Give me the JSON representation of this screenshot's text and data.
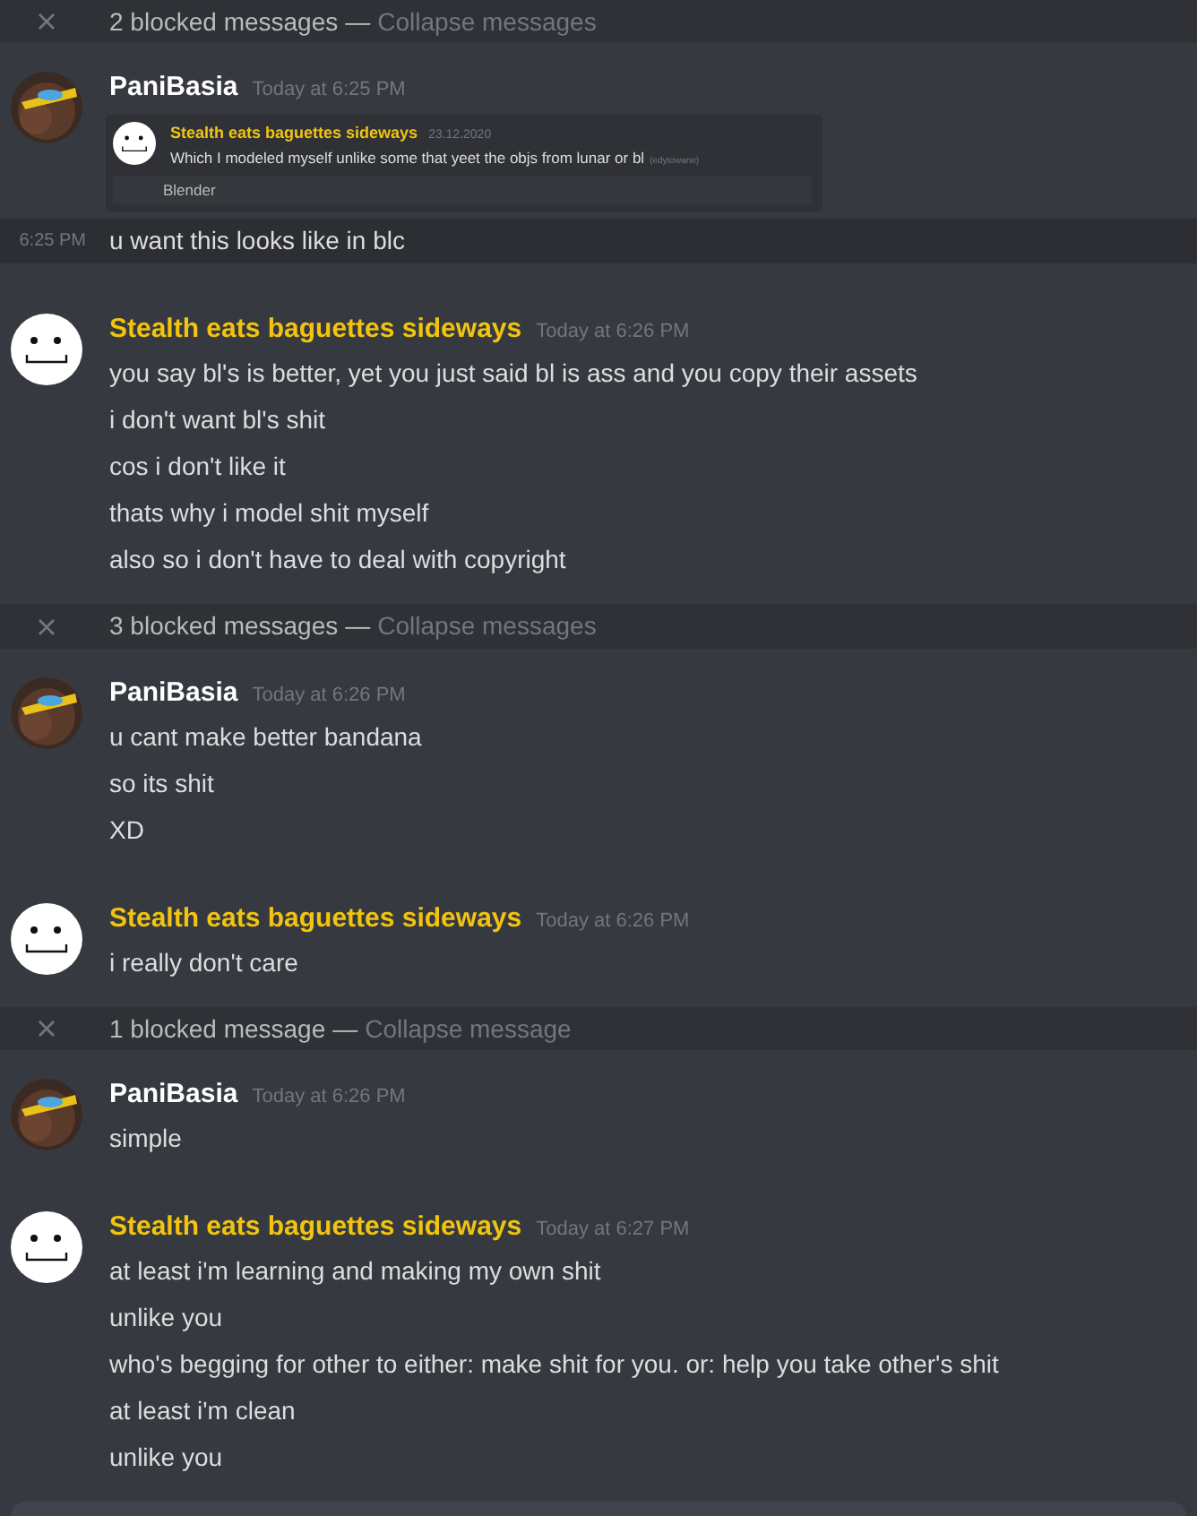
{
  "items": [
    {
      "kind": "blocked",
      "label": "2 blocked messages",
      "separator": "—",
      "action": "Collapse messages"
    },
    {
      "kind": "message",
      "author": "PaniBasia",
      "color": "#ffffff",
      "timestamp": "Today at 6:25 PM",
      "embed": {
        "author": "Stealth eats baguettes sideways",
        "color": "#f1c40f",
        "date": "23.12.2020",
        "text": "Which I modeled myself unlike some that yeet the objs from lunar or bl",
        "note": "(edytowane)",
        "footer": "Blender"
      },
      "lines": [
        {
          "text": "u want this looks like in blc",
          "time": "6:25 PM",
          "highlighted": true
        }
      ]
    },
    {
      "kind": "message",
      "avatar": {
        "kind": "smiley"
      },
      "author": "Stealth eats baguettes sideways",
      "color": "#f1c40f",
      "timestamp": "Today at 6:26 PM",
      "lines": [
        {
          "text": "you say bl's is better, yet you just said bl is ass and you copy their assets"
        },
        {
          "text": "i don't want bl's shit"
        },
        {
          "text": "cos i don't like it"
        },
        {
          "text": "thats why i model shit myself"
        },
        {
          "text": "also so i don't have to deal with copyright"
        }
      ]
    },
    {
      "kind": "blocked",
      "label": "3 blocked messages",
      "separator": "—",
      "action": "Collapse messages"
    },
    {
      "kind": "message",
      "author": "PaniBasia",
      "color": "#ffffff",
      "timestamp": "Today at 6:26 PM",
      "lines": [
        {
          "text": "u cant make better bandana"
        },
        {
          "text": "so its shit"
        },
        {
          "text": "XD"
        }
      ]
    },
    {
      "kind": "message",
      "avatar": {
        "kind": "smiley"
      },
      "author": "Stealth eats baguettes sideways",
      "color": "#f1c40f",
      "timestamp": "Today at 6:26 PM",
      "lines": [
        {
          "text": "i really don't care"
        }
      ]
    },
    {
      "kind": "blocked",
      "label": "1 blocked message",
      "separator": "—",
      "action": "Collapse message"
    },
    {
      "kind": "message",
      "author": "PaniBasia",
      "color": "#ffffff",
      "timestamp": "Today at 6:26 PM",
      "lines": [
        {
          "text": "simple"
        }
      ]
    },
    {
      "kind": "message",
      "avatar": {
        "kind": "smiley"
      },
      "author": "Stealth eats baguettes sideways",
      "color": "#f1c40f",
      "timestamp": "Today at 6:27 PM",
      "lines": [
        {
          "text": "at least i'm learning and making my own shit"
        },
        {
          "text": "unlike you"
        },
        {
          "text": "who's begging for other to either: make shit for you. or: help you take other's shit"
        },
        {
          "text": "at least i'm clean"
        },
        {
          "text": "unlike you"
        }
      ]
    }
  ]
}
